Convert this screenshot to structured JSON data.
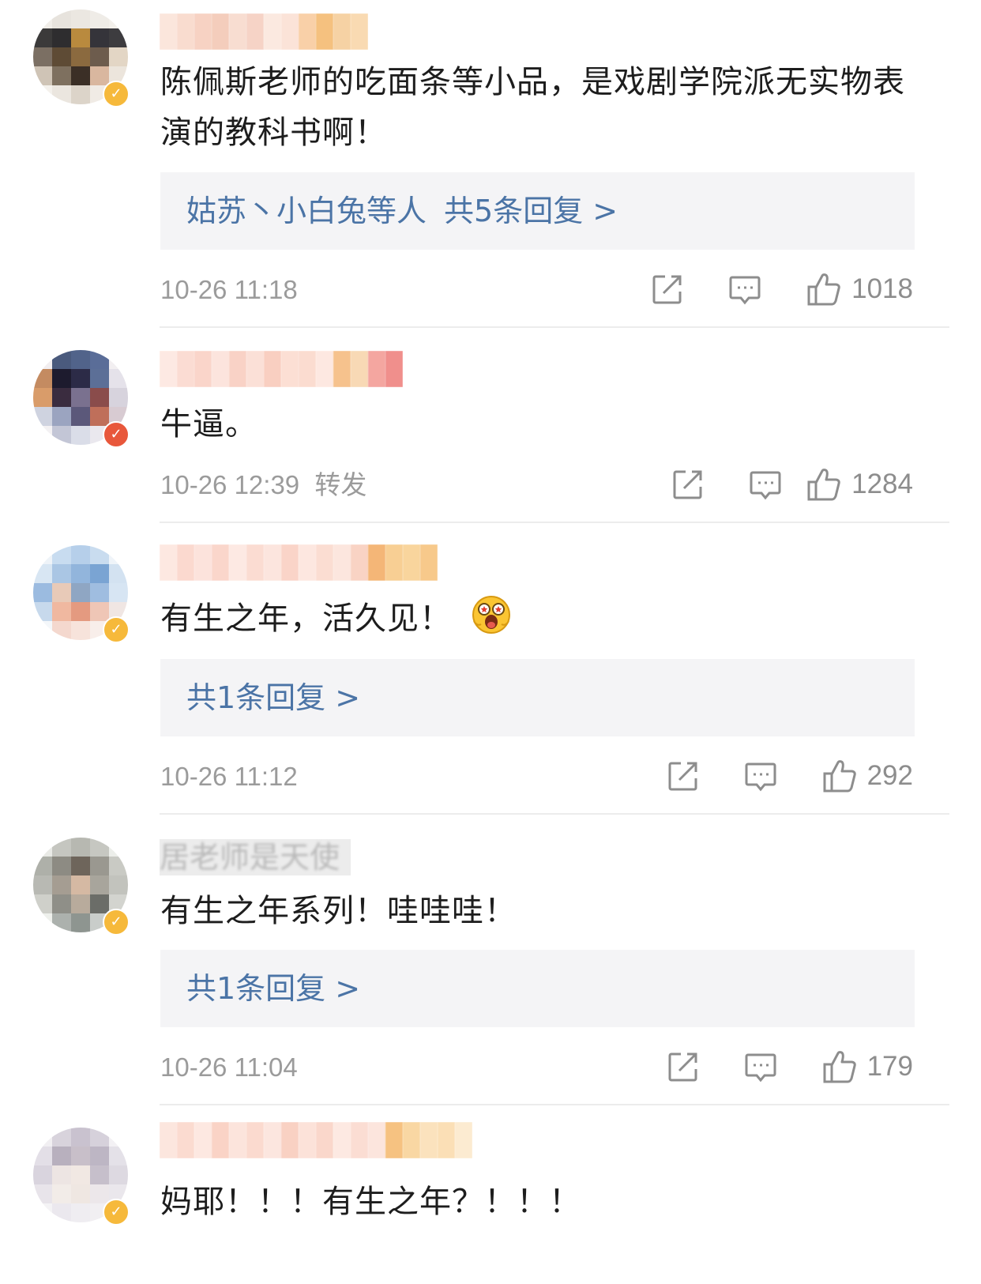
{
  "comments": [
    {
      "text": "陈佩斯老师的吃面条等小品，是戏剧学院派无实物表演的教科书啊！",
      "reply_users": "姑苏丶小白兔等人",
      "reply_count": "共5条回复 >",
      "time": "10-26 11:18",
      "tag": "",
      "likes": "1018",
      "badge_color": "#f6b93b"
    },
    {
      "text": "牛逼。",
      "reply_users": "",
      "reply_count": "",
      "time": "10-26 12:39",
      "tag": "转发",
      "likes": "1284",
      "badge_color": "#e8573b"
    },
    {
      "text": "有生之年，活久见！",
      "reply_users": "",
      "reply_count": "共1条回复 >",
      "time": "10-26 11:12",
      "tag": "",
      "likes": "292",
      "badge_color": "#f6b93b",
      "emoji": "surprised-face-emoji"
    },
    {
      "username": "居老师是天使",
      "text": "有生之年系列！哇哇哇！",
      "reply_users": "",
      "reply_count": "共1条回复 >",
      "time": "10-26 11:04",
      "tag": "",
      "likes": "179",
      "badge_color": "#f6b93b"
    },
    {
      "text": "妈耶！！！有生之年？！！！",
      "reply_users": "",
      "reply_count": "",
      "time": "",
      "tag": "",
      "likes": "",
      "badge_color": "#f6b93b"
    }
  ],
  "icons": {
    "share": "share-icon",
    "comment": "comment-icon",
    "like": "thumbs-up-icon",
    "verified": "verified-badge-icon"
  },
  "colors": {
    "link": "#4b74a6",
    "meta": "#9b9b9b",
    "reply_bg": "#f4f4f6",
    "verified_gold": "#f6b93b",
    "verified_red": "#e8573b"
  }
}
